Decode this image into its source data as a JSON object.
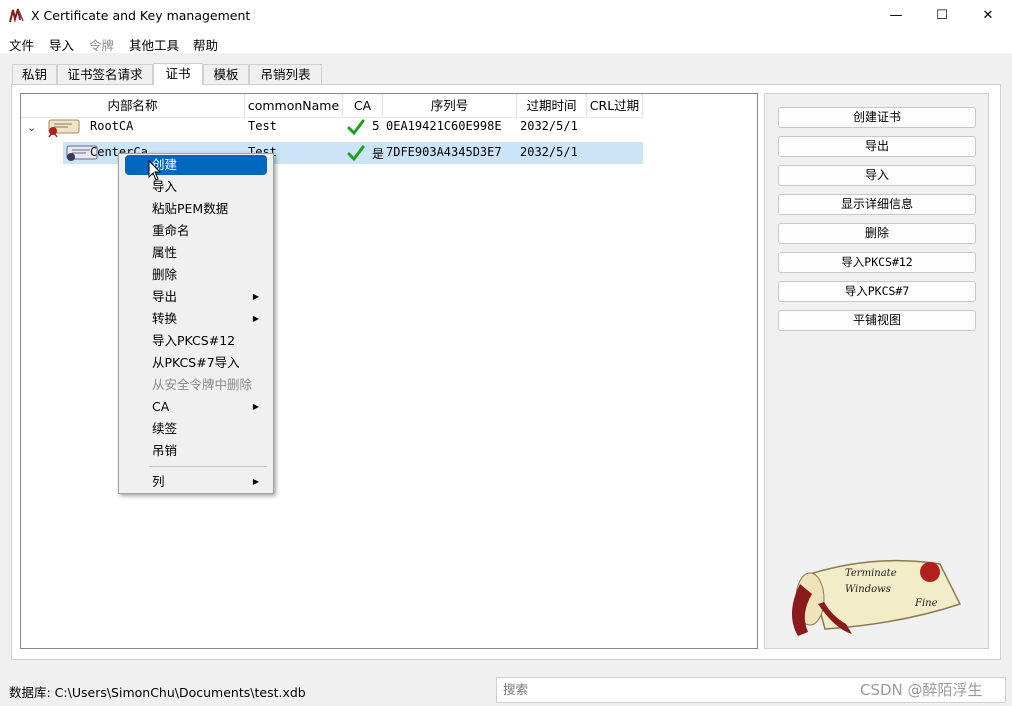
{
  "window": {
    "title": "X Certificate and Key management",
    "minimize": "—",
    "maximize": "☐",
    "close": "✕"
  },
  "menu": [
    "文件",
    "导入",
    "令牌",
    "其他工具",
    "帮助"
  ],
  "tabs": [
    "私钥",
    "证书签名请求",
    "证书",
    "模板",
    "吊销列表"
  ],
  "active_tab": "证书",
  "table": {
    "headers": [
      "内部名称",
      "commonName",
      "CA",
      "序列号",
      "过期时间",
      "CRL过期"
    ],
    "rows": [
      {
        "expander": "⌄",
        "name": "RootCA",
        "commonName": "Test",
        "ca": "5",
        "serial": "0EA19421C60E998E",
        "expiry": "2032/5/1"
      },
      {
        "name": "CenterCa",
        "commonName": "Test",
        "ca": "是",
        "serial": "7DFE903A4345D3E7",
        "expiry": "2032/5/1"
      }
    ]
  },
  "side_buttons": [
    "创建证书",
    "导出",
    "导入",
    "显示详细信息",
    "删除",
    "导入PKCS#12",
    "导入PKCS#7",
    "平铺视图"
  ],
  "context_menu": {
    "items": [
      "创建",
      "导入",
      "粘贴PEM数据",
      "重命名",
      "属性",
      "删除",
      "导出",
      "转换",
      "导入PKCS#12",
      "从PKCS#7导入",
      "从安全令牌中删除",
      "CA",
      "续签",
      "吊销",
      "列"
    ],
    "submenu_arrow": "▶",
    "highlighted": "创建",
    "disabled": [
      "从安全令牌中删除"
    ]
  },
  "scroll_art": {
    "line1": "Terminate",
    "line2": "Windows",
    "line3": "Fine"
  },
  "status": {
    "database_label": "数据库: C:\\Users\\SimonChu\\Documents\\test.xdb",
    "search_placeholder": "搜索",
    "watermark": "CSDN @醉陌浮生"
  },
  "colors": {
    "selection": "#cce4f7",
    "menu_highlight": "#0067c0",
    "check": "#1aa31a"
  }
}
